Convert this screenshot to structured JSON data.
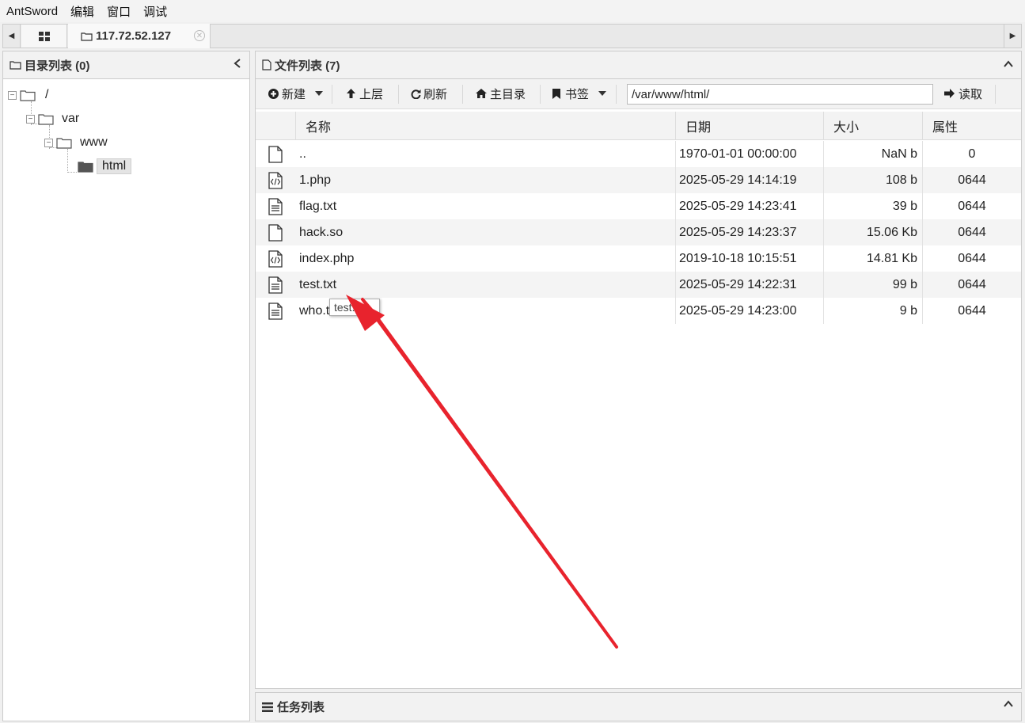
{
  "menu": [
    "AntSword",
    "编辑",
    "窗口",
    "调试"
  ],
  "tabs": {
    "active_label": "117.72.52.127"
  },
  "left_panel": {
    "title": "目录列表 (0)",
    "tree": [
      {
        "label": "/"
      },
      {
        "label": "var"
      },
      {
        "label": "www"
      },
      {
        "label": "html"
      }
    ]
  },
  "right_panel": {
    "title": "文件列表 (7)",
    "toolbar": {
      "new_label": "新建",
      "up_label": "上层",
      "refresh_label": "刷新",
      "home_label": "主目录",
      "bookmark_label": "书签",
      "path_value": "/var/www/html/",
      "read_label": "读取"
    },
    "columns": [
      "名称",
      "日期",
      "大小",
      "属性"
    ],
    "rows": [
      {
        "icon": "file-icon",
        "name": "..",
        "date": "1970-01-01 00:00:00",
        "size": "NaN b",
        "attr": "0"
      },
      {
        "icon": "code-file-icon",
        "name": "1.php",
        "date": "2025-05-29 14:14:19",
        "size": "108 b",
        "attr": "0644"
      },
      {
        "icon": "text-file-icon",
        "name": "flag.txt",
        "date": "2025-05-29 14:23:41",
        "size": "39 b",
        "attr": "0644"
      },
      {
        "icon": "file-icon",
        "name": "hack.so",
        "date": "2025-05-29 14:23:37",
        "size": "15.06 Kb",
        "attr": "0644"
      },
      {
        "icon": "code-file-icon",
        "name": "index.php",
        "date": "2019-10-18 10:15:51",
        "size": "14.81 Kb",
        "attr": "0644"
      },
      {
        "icon": "text-file-icon",
        "name": "test.txt",
        "date": "2025-05-29 14:22:31",
        "size": "99 b",
        "attr": "0644"
      },
      {
        "icon": "text-file-icon",
        "name": "who.t",
        "date": "2025-05-29 14:23:00",
        "size": "9 b",
        "attr": "0644"
      }
    ],
    "tooltip": "test.txt"
  },
  "bottom_panel": {
    "title": "任务列表"
  },
  "annotation": {
    "arrow_color": "#e8232d"
  }
}
